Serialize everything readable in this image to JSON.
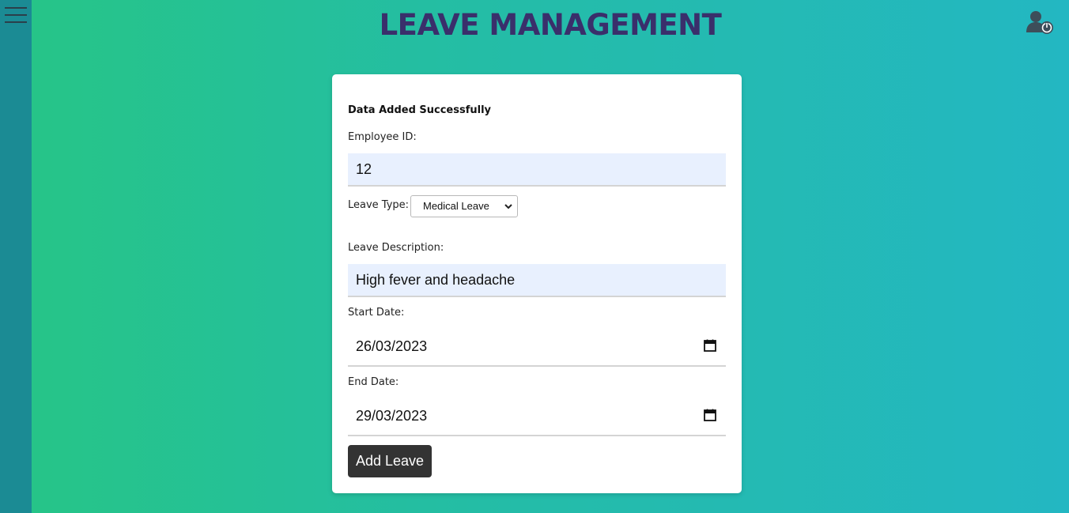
{
  "header": {
    "title": "LEAVE MANAGEMENT"
  },
  "icons": {
    "menu": "hamburger-menu-icon",
    "user": "user-logout-icon",
    "calendar": "calendar-icon",
    "dropdown": "chevron-down-icon"
  },
  "colors": {
    "gradient_start": "#26c586",
    "gradient_end": "#23b7c2",
    "sidebar": "#1b8b94",
    "title": "#3a2f6b",
    "button": "#333333",
    "input_bg": "#e8f0fe"
  },
  "form": {
    "status_message": "Data Added Successfully",
    "employee_id": {
      "label": "Employee ID:",
      "value": "12"
    },
    "leave_type": {
      "label": "Leave Type:",
      "selected": "Medical Leave"
    },
    "leave_description": {
      "label": "Leave Description:",
      "value": "High fever and headache"
    },
    "start_date": {
      "label": "Start Date:",
      "value": "26/03/2023"
    },
    "end_date": {
      "label": "End Date:",
      "value": "29/03/2023"
    },
    "submit_label": "Add Leave"
  }
}
